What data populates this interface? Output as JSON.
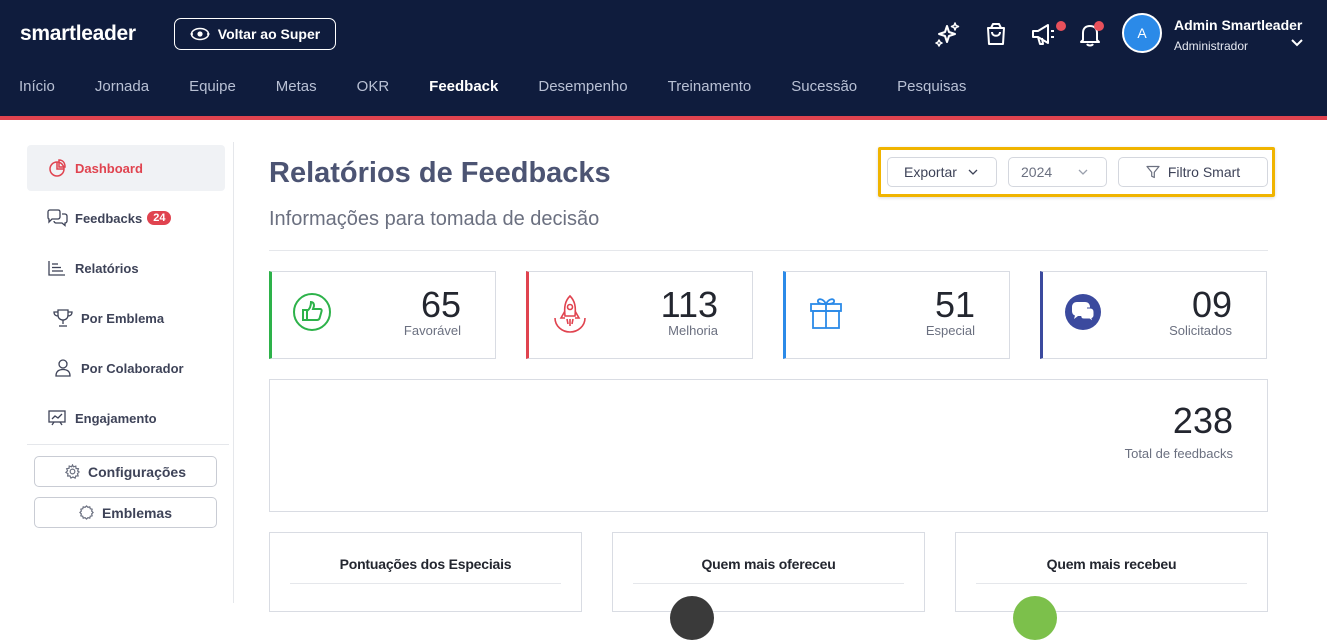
{
  "header": {
    "logo": "smartleader",
    "back_button": "Voltar ao Super",
    "user": {
      "initial": "A",
      "name": "Admin Smartleader",
      "role": "Administrador"
    },
    "colors": {
      "navy": "#0f1c3d",
      "accent": "#e0434f"
    }
  },
  "nav": {
    "items": [
      "Início",
      "Jornada",
      "Equipe",
      "Metas",
      "OKR",
      "Feedback",
      "Desempenho",
      "Treinamento",
      "Sucessão",
      "Pesquisas"
    ],
    "active": "Feedback"
  },
  "sidebar": {
    "items": [
      {
        "label": "Dashboard",
        "icon": "pie-chart-icon"
      },
      {
        "label": "Feedbacks",
        "icon": "chat-bubbles-icon",
        "badge": "24"
      },
      {
        "label": "Relatórios",
        "icon": "bar-list-icon"
      },
      {
        "label": "Por Emblema",
        "icon": "trophy-icon"
      },
      {
        "label": "Por Colaborador",
        "icon": "person-icon"
      },
      {
        "label": "Engajamento",
        "icon": "presentation-icon"
      }
    ],
    "buttons": [
      {
        "label": "Configurações",
        "icon": "gear-icon"
      },
      {
        "label": "Emblemas",
        "icon": "badge-icon"
      }
    ]
  },
  "page": {
    "title": "Relatórios de Feedbacks",
    "subtitle": "Informações para tomada de decisão"
  },
  "filters": {
    "export_label": "Exportar",
    "year_value": "2024",
    "smart_filter_label": "Filtro Smart"
  },
  "stats": [
    {
      "value": "65",
      "label": "Favorável",
      "color": "#2db24a",
      "icon": "thumbs-up-icon"
    },
    {
      "value": "113",
      "label": "Melhoria",
      "color": "#e0434f",
      "icon": "rocket-icon"
    },
    {
      "value": "51",
      "label": "Especial",
      "color": "#2b8ae8",
      "icon": "gift-icon"
    },
    {
      "value": "09",
      "label": "Solicitados",
      "color": "#3b4a9e",
      "icon": "chat-request-icon"
    }
  ],
  "total": {
    "value": "238",
    "label": "Total de feedbacks"
  },
  "panels": [
    {
      "title": "Pontuações dos Especiais"
    },
    {
      "title": "Quem mais ofereceu"
    },
    {
      "title": "Quem mais recebeu"
    }
  ]
}
